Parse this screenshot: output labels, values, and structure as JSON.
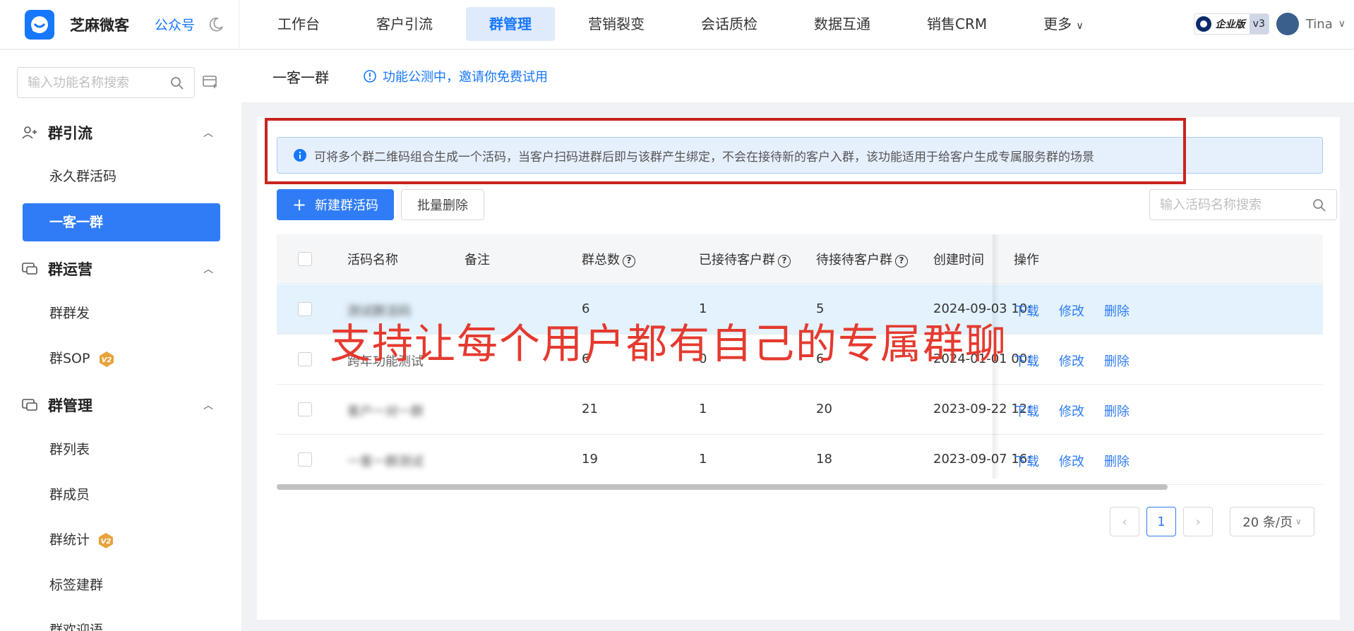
{
  "topbar": {
    "brand": "芝麻微客",
    "gzh": "公众号",
    "nav": [
      "工作台",
      "客户引流",
      "群管理",
      "营销裂变",
      "会话质检",
      "数据互通",
      "销售CRM",
      "更多"
    ],
    "active_nav": "群管理",
    "enterprise": "企业版",
    "version": "v3",
    "user": "Tina"
  },
  "sidebar": {
    "search_placeholder": "输入功能名称搜索",
    "groups": [
      {
        "title": "群引流",
        "items": [
          "永久群活码",
          "一客一群"
        ]
      },
      {
        "title": "群运营",
        "items": [
          "群群发",
          "群SOP"
        ]
      },
      {
        "title": "群管理",
        "items": [
          "群列表",
          "群成员",
          "群统计",
          "标签建群",
          "群欢迎语"
        ]
      }
    ],
    "active_item": "一客一群"
  },
  "page": {
    "title": "一客一群",
    "tip": "功能公测中，邀请你免费试用"
  },
  "alert": "可将多个群二维码组合生成一个活码，当客户扫码进群后即与该群产生绑定，不会在接待新的客户入群，该功能适用于给客户生成专属服务群的场景",
  "toolbar": {
    "new_label": "新建群活码",
    "batch_delete_label": "批量删除",
    "search_placeholder": "输入活码名称搜索"
  },
  "table": {
    "headers": [
      "活码名称",
      "备注",
      "群总数",
      "已接待客户群",
      "待接待客户群",
      "创建时间",
      "操作"
    ],
    "rows": [
      {
        "name": "测试群活码",
        "note": "",
        "total": "6",
        "received": "1",
        "pending": "5",
        "created": "2024-09-03 10:"
      },
      {
        "name": "跨年功能测试",
        "note": "",
        "total": "6",
        "received": "0",
        "pending": "6",
        "created": "2024-01-01 00:"
      },
      {
        "name": "客户一对一群",
        "note": "",
        "total": "21",
        "received": "1",
        "pending": "20",
        "created": "2023-09-22 12:"
      },
      {
        "name": "一客一群测试",
        "note": "",
        "total": "19",
        "received": "1",
        "pending": "18",
        "created": "2023-09-07 16:"
      }
    ],
    "actions": [
      "下载",
      "修改",
      "删除"
    ]
  },
  "pagination": {
    "current": "1",
    "page_size": "20 条/页"
  },
  "overlay": "支持让每个用户都有自己的专属群聊",
  "colors": {
    "primary": "#2f7cf6",
    "overlay_red": "#e53a2f",
    "highlight_box": "#c8251d"
  }
}
